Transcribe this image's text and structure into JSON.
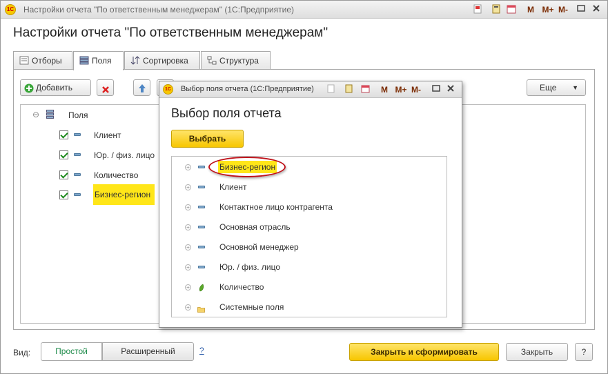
{
  "window": {
    "title": "Настройки отчета \"По ответственным менеджерам\"  (1С:Предприятие)",
    "logo_text": "1С",
    "toolbar_m": [
      "M",
      "M+",
      "M-"
    ]
  },
  "page": {
    "heading": "Настройки отчета \"По ответственным менеджерам\""
  },
  "tabs": [
    {
      "label": "Отборы",
      "active": false
    },
    {
      "label": "Поля",
      "active": true
    },
    {
      "label": "Сортировка",
      "active": false
    },
    {
      "label": "Структура",
      "active": false
    }
  ],
  "toolbar": {
    "add_label": "Добавить",
    "more_label": "Еще"
  },
  "fields_tree": {
    "root_label": "Поля",
    "items": [
      {
        "label": "Клиент",
        "checked": true,
        "highlight": false
      },
      {
        "label": "Юр. / физ. лицо",
        "checked": true,
        "highlight": false
      },
      {
        "label": "Количество",
        "checked": true,
        "highlight": false
      },
      {
        "label": "Бизнес-регион",
        "checked": true,
        "highlight": true
      }
    ]
  },
  "dialog": {
    "title": "Выбор поля отчета  (1С:Предприятие)",
    "heading": "Выбор поля отчета",
    "select_label": "Выбрать",
    "toolbar_m": [
      "M",
      "M+",
      "M-"
    ],
    "items": [
      {
        "label": "Бизнес-регион",
        "icon": "dash-icon",
        "highlight": true
      },
      {
        "label": "Клиент",
        "icon": "dash-icon",
        "highlight": false
      },
      {
        "label": "Контактное лицо контрагента",
        "icon": "dash-icon",
        "highlight": false
      },
      {
        "label": "Основная отрасль",
        "icon": "dash-icon",
        "highlight": false
      },
      {
        "label": "Основной менеджер",
        "icon": "dash-icon",
        "highlight": false
      },
      {
        "label": "Юр. / физ. лицо",
        "icon": "dash-icon",
        "highlight": false
      },
      {
        "label": "Количество",
        "icon": "resource-icon",
        "highlight": false
      },
      {
        "label": "Системные поля",
        "icon": "folder-icon",
        "highlight": false
      }
    ]
  },
  "footer": {
    "view_label": "Вид:",
    "simple_label": "Простой",
    "extended_label": "Расширенный",
    "help_link": "?",
    "generate_label": "Закрыть и сформировать",
    "close_label": "Закрыть",
    "help_label": "?"
  },
  "colors": {
    "accent_yellow": "#f7c600",
    "highlight": "#ffe619",
    "oval_red": "#c0141c",
    "check_green": "#1e8b1e"
  }
}
